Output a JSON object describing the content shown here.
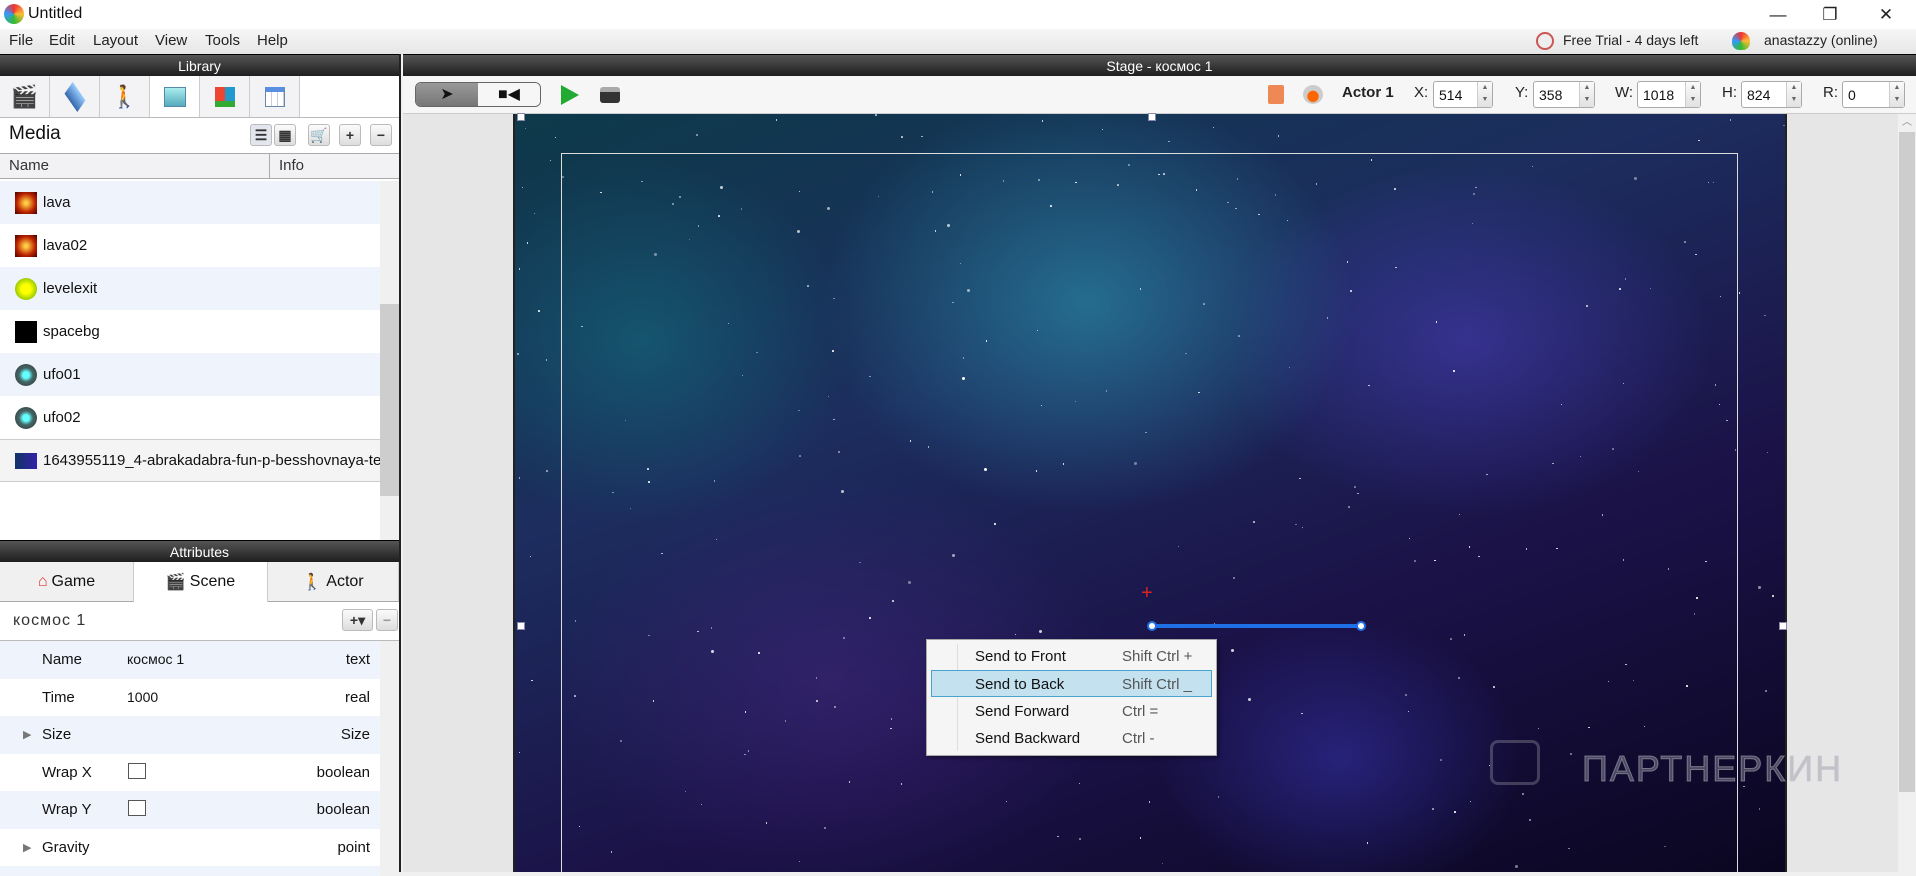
{
  "window": {
    "title": "Untitled",
    "minimize": "—",
    "restore": "❐",
    "close": "✕"
  },
  "menu": [
    "File",
    "Edit",
    "Layout",
    "View",
    "Tools",
    "Help"
  ],
  "status": {
    "trial": "Free Trial - 4 days left",
    "user": "anastazzy (online)"
  },
  "library": {
    "title": "Library",
    "section": "Media",
    "columns": [
      "Name",
      "Info"
    ],
    "items": [
      {
        "name": "lava",
        "thumb": "lava"
      },
      {
        "name": "lava02",
        "thumb": "lava"
      },
      {
        "name": "levelexit",
        "thumb": "exit"
      },
      {
        "name": "spacebg",
        "thumb": "space"
      },
      {
        "name": "ufo01",
        "thumb": "ufo"
      },
      {
        "name": "ufo02",
        "thumb": "ufo"
      },
      {
        "name": "1643955119_4-abrakadabra-fun-p-besshovnaya-te",
        "thumb": "nebula"
      }
    ]
  },
  "attributes": {
    "title": "Attributes",
    "tabs": [
      "Game",
      "Scene",
      "Actor"
    ],
    "scene_name": "космос 1",
    "add": "+▾",
    "remove": "−",
    "rows": [
      {
        "label": "Name",
        "value": "космос 1",
        "type": "text"
      },
      {
        "label": "Time",
        "value": "1000",
        "type": "real"
      },
      {
        "label": "Size",
        "value": "",
        "type": "Size",
        "expand": true
      },
      {
        "label": "Wrap X",
        "checkbox": false,
        "type": "boolean"
      },
      {
        "label": "Wrap Y",
        "checkbox": false,
        "type": "boolean"
      },
      {
        "label": "Gravity",
        "value": "",
        "type": "point",
        "expand": true
      }
    ]
  },
  "stage": {
    "title": "Stage - космос 1",
    "actor": "Actor 1",
    "fields": [
      {
        "label": "X:",
        "value": "514"
      },
      {
        "label": "Y:",
        "value": "358"
      },
      {
        "label": "W:",
        "value": "1018"
      },
      {
        "label": "H:",
        "value": "824"
      },
      {
        "label": "R:",
        "value": "0"
      }
    ]
  },
  "context_menu": [
    {
      "label": "Send to Front",
      "shortcut": "Shift Ctrl +"
    },
    {
      "label": "Send to Back",
      "shortcut": "Shift Ctrl _",
      "selected": true
    },
    {
      "label": "Send Forward",
      "shortcut": "Ctrl ="
    },
    {
      "label": "Send Backward",
      "shortcut": "Ctrl -"
    }
  ],
  "watermark": "ПАРТНЕРКИН"
}
